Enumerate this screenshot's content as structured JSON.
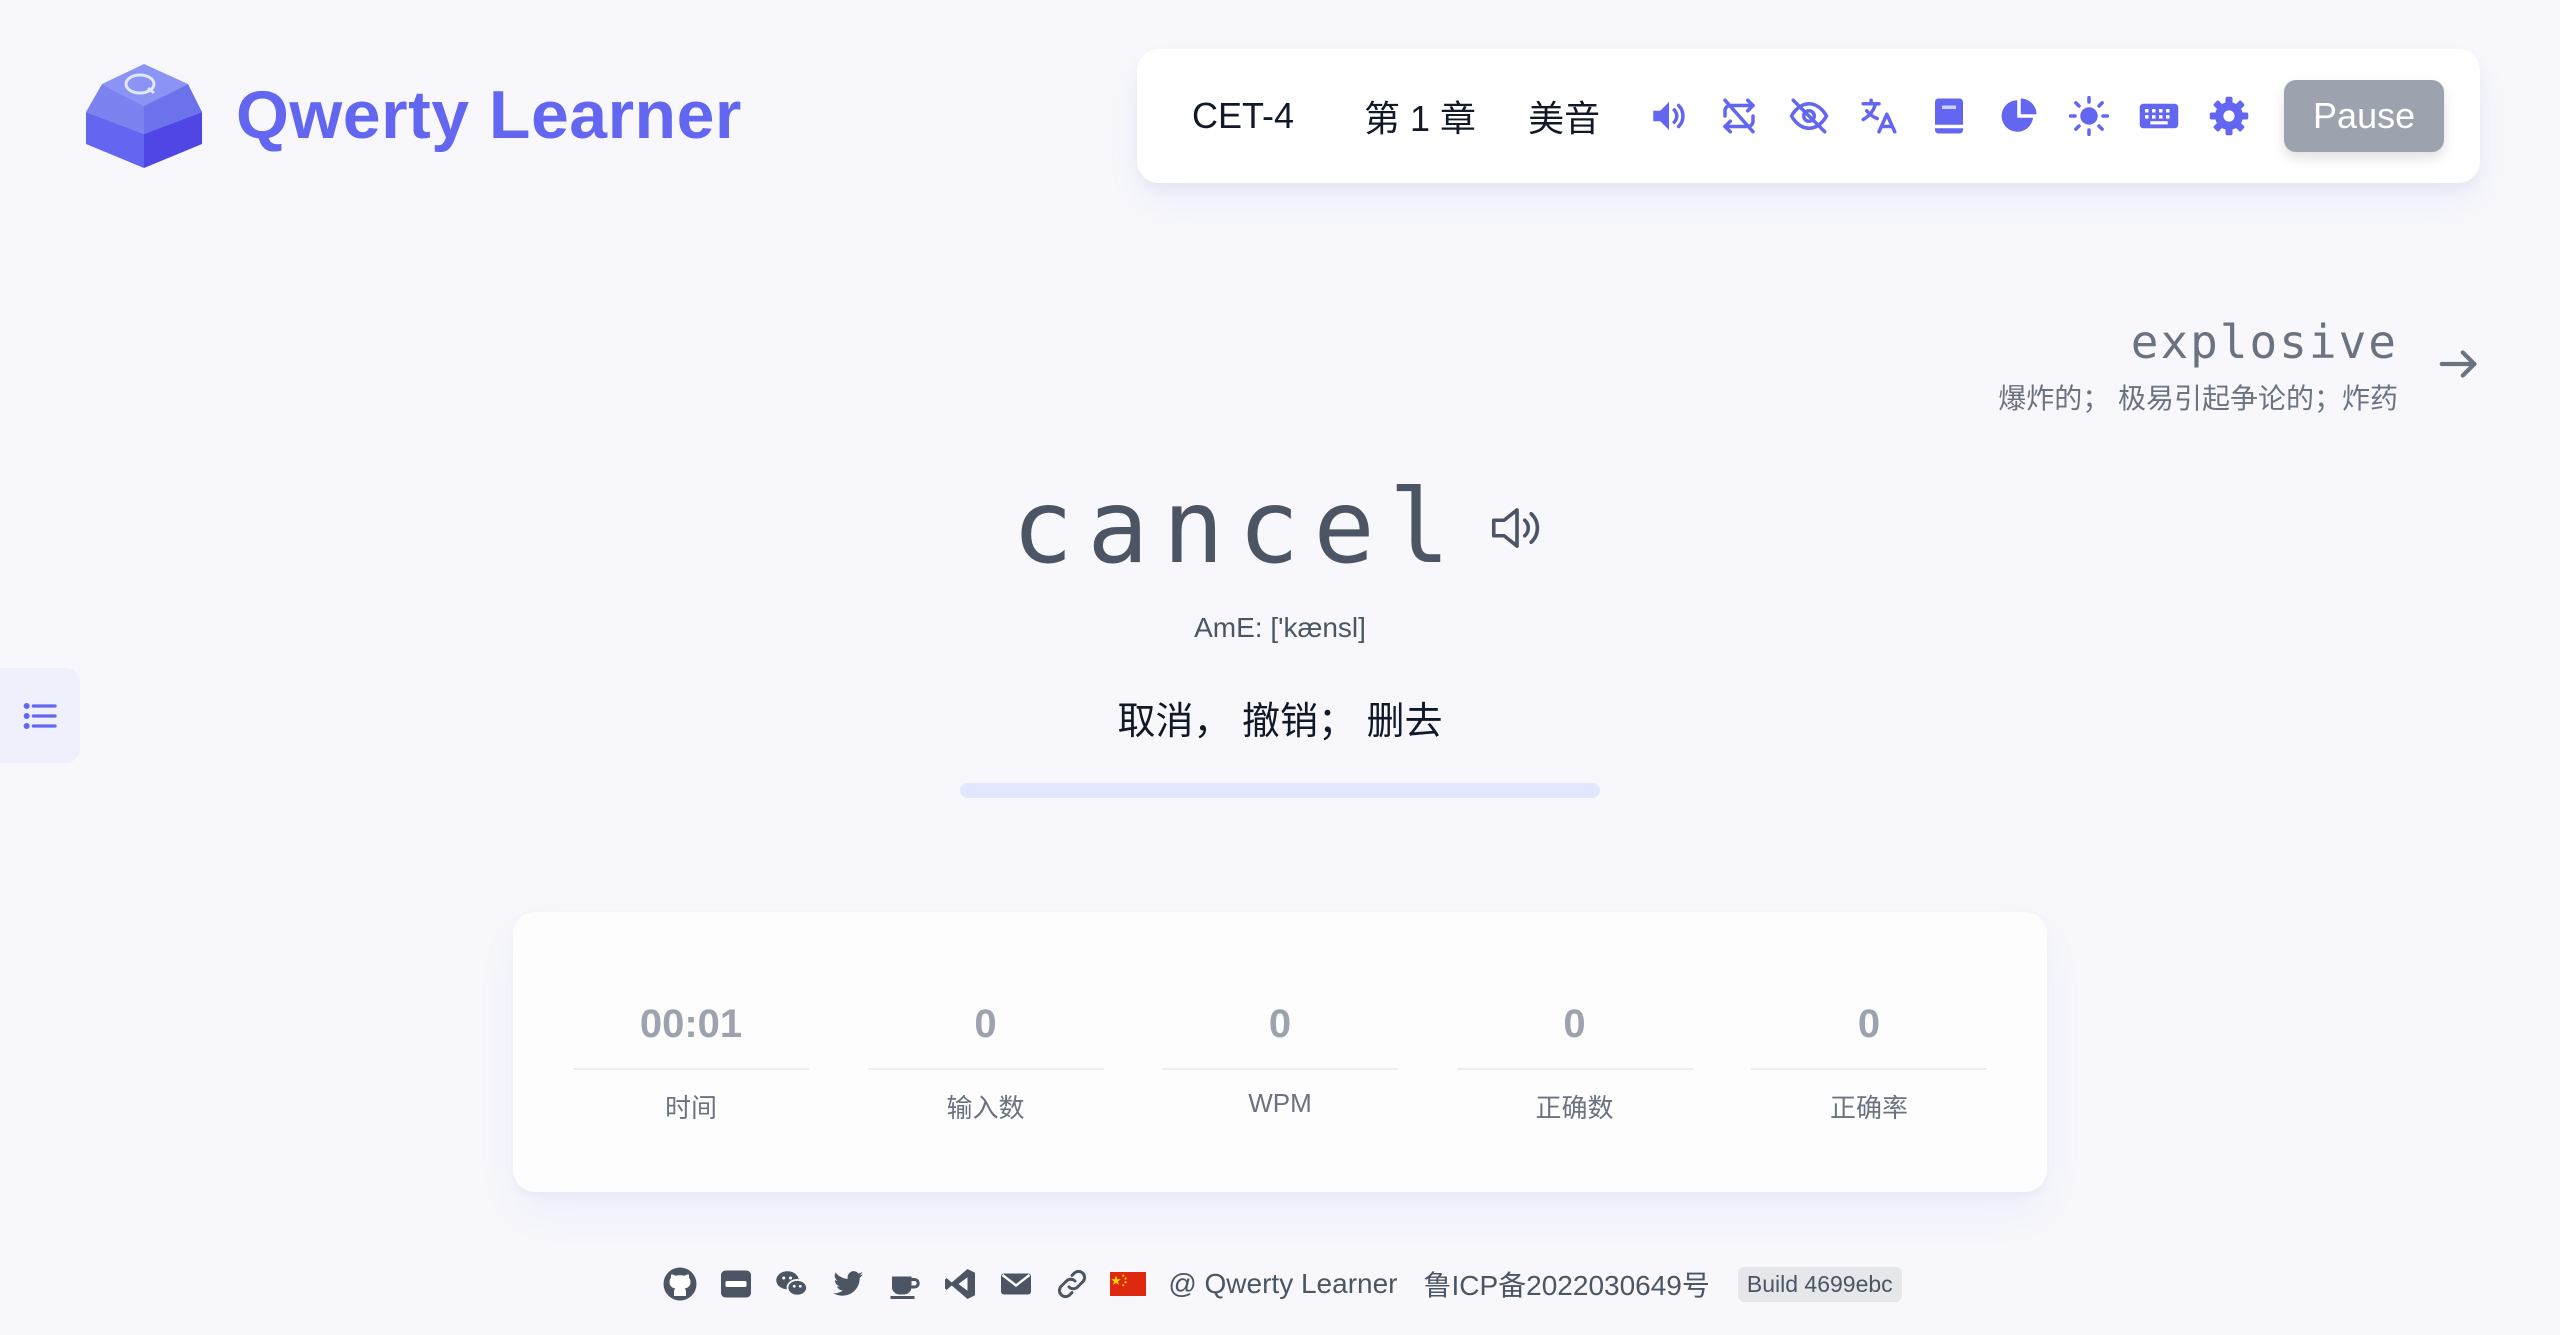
{
  "app": {
    "title": "Qwerty Learner"
  },
  "toolbar": {
    "dictionary": "CET-4",
    "chapter": "第 1 章",
    "accent": "美音",
    "pause_label": "Pause"
  },
  "next_word": {
    "name": "explosive",
    "trans": "爆炸的； 极易引起争论的；炸药"
  },
  "word": {
    "text": "cancel",
    "phonetic": "AmE: ['kænsl]",
    "translation": "取消， 撤销； 删去",
    "progress": 0
  },
  "stats": [
    {
      "value": "00:01",
      "label": "时间"
    },
    {
      "value": "0",
      "label": "输入数"
    },
    {
      "value": "0",
      "label": "WPM"
    },
    {
      "value": "0",
      "label": "正确数"
    },
    {
      "value": "0",
      "label": "正确率"
    }
  ],
  "footer": {
    "copyright": "@ Qwerty Learner",
    "icp": "鲁ICP备2022030649号",
    "build": "Build 4699ebc"
  },
  "colors": {
    "accent": "#6366f1",
    "icon": "#6366f1",
    "pause_bg": "#9ca3af",
    "background": "#f8f8fc"
  }
}
